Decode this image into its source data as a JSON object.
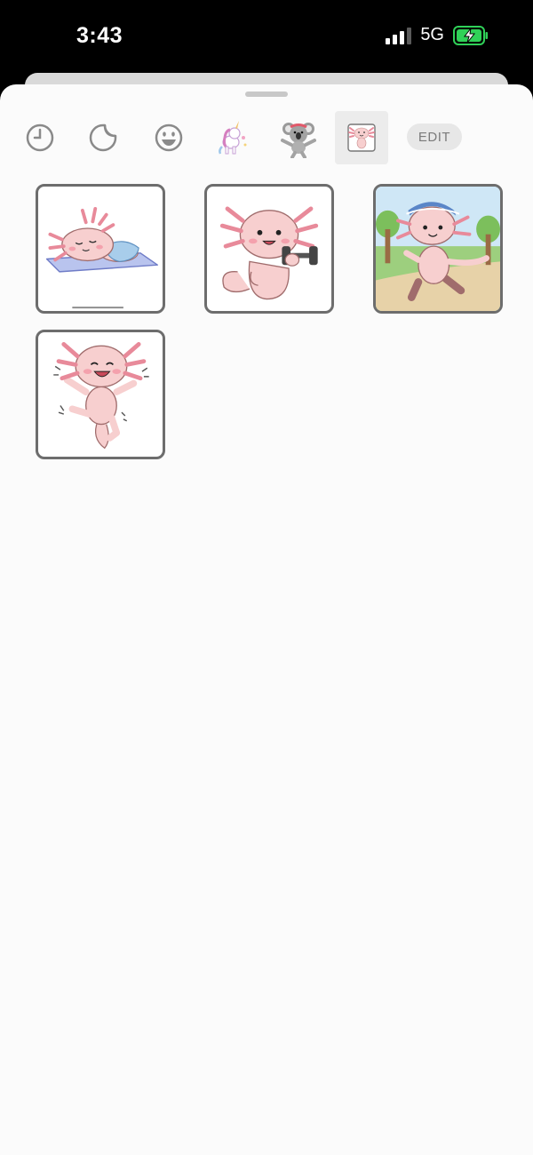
{
  "status_bar": {
    "time": "3:43",
    "network": "5G",
    "battery_state": "charging",
    "battery_color": "#30d158"
  },
  "toolbar": {
    "tabs": [
      {
        "name": "recent-clock-icon"
      },
      {
        "name": "sticker-peel-icon"
      },
      {
        "name": "smiley-face-icon"
      },
      {
        "name": "unicorn-sticker-pack-icon"
      },
      {
        "name": "koala-sticker-pack-icon"
      },
      {
        "name": "axolotl-sticker-pack-icon",
        "selected": true
      }
    ],
    "edit_label": "EDIT"
  },
  "stickers": [
    {
      "name": "sticker-axolotl-sleeping"
    },
    {
      "name": "sticker-axolotl-dumbbell"
    },
    {
      "name": "sticker-axolotl-running"
    },
    {
      "name": "sticker-axolotl-dancing"
    }
  ],
  "colors": {
    "axolotl_pink": "#f7cfcf",
    "gill_pink": "#e88a9a",
    "sheet_background": "#fbfbfb"
  }
}
